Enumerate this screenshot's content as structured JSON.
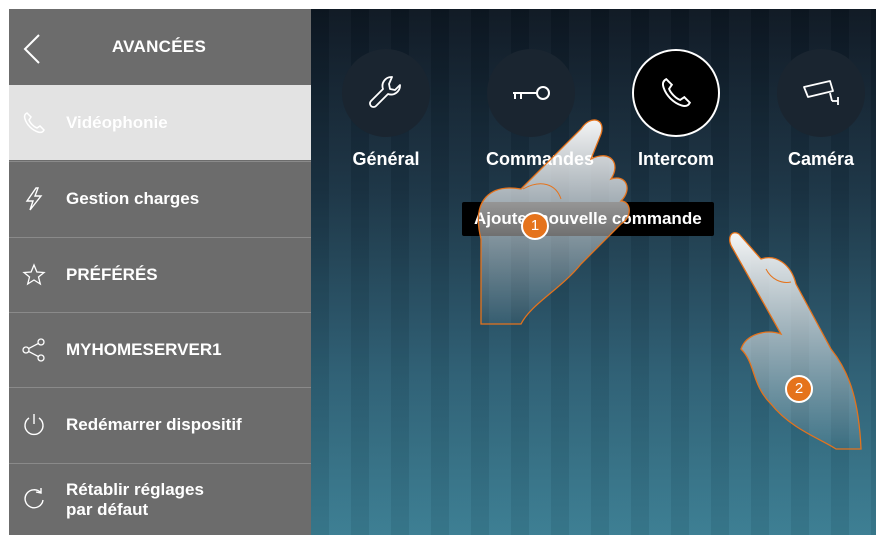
{
  "sidebar": {
    "title": "AVANCÉES",
    "items": [
      {
        "label": "Vidéophonie",
        "icon": "phone-icon",
        "active": true
      },
      {
        "label": "Gestion charges",
        "icon": "lightning-icon",
        "active": false
      },
      {
        "label": "PRÉFÉRÉS",
        "icon": "star-icon",
        "active": false
      },
      {
        "label": "MYHOMESERVER1",
        "icon": "share-icon",
        "active": false
      },
      {
        "label": "Redémarrer dispositif",
        "icon": "power-icon",
        "active": false
      },
      {
        "label_line1": "Rétablir réglages",
        "label_line2": "par défaut",
        "icon": "reset-icon",
        "active": false
      }
    ]
  },
  "main": {
    "tiles": [
      {
        "label": "Général",
        "icon": "wrench-icon"
      },
      {
        "label": "Commandes",
        "icon": "key-icon"
      },
      {
        "label": "Intercom",
        "icon": "phone-icon",
        "selected": true
      },
      {
        "label": "Caméra",
        "icon": "camera-icon"
      }
    ],
    "tooltip": "Ajouter nouvelle commande"
  },
  "steps": [
    "1",
    "2"
  ],
  "colors": {
    "sidebar": "#6c6c6c",
    "active_item": "#e3e3e3",
    "step_badge": "#e5731c"
  }
}
